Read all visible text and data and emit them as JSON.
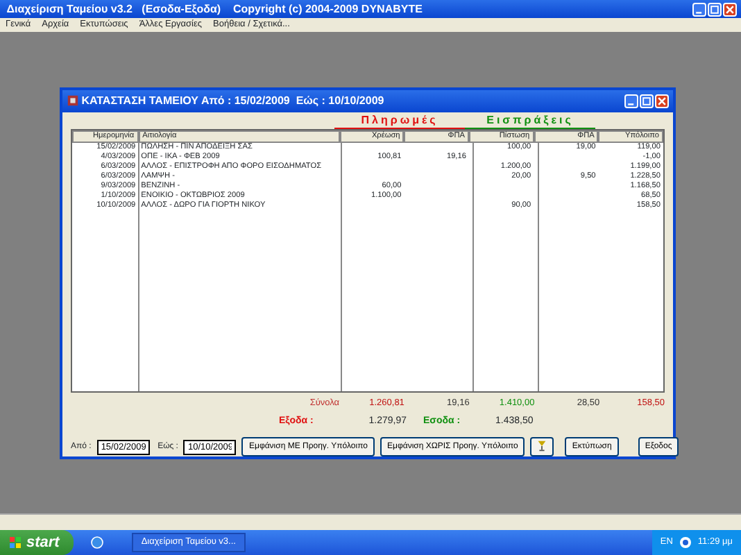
{
  "app": {
    "title": "Διαχείριση Ταμείου v3.2   (Εσοδα-Εξοδα)    Copyright (c) 2004-2009 DYNABYTE"
  },
  "menu": [
    "Γενικά",
    "Αρχεία",
    "Εκτυπώσεις",
    "Άλλες Εργασίες",
    "Βοήθεια / Σχετικά..."
  ],
  "report_window": {
    "title": "ΚΑΤΑΣΤΑΣΗ ΤΑΜΕΙΟΥ Από : 15/02/2009  Εώς : 10/10/2009",
    "groups": [
      {
        "label": "Πληρωμές",
        "color": "#e01010"
      },
      {
        "label": "Εισπράξεις",
        "color": "#109010"
      }
    ],
    "columns": [
      "Ημερομηνία",
      "Αιτιολογία",
      "Χρέωση",
      "ΦΠΑ",
      "Πίστωση",
      "ΦΠΑ",
      "Υπόλοιπο"
    ],
    "rows": [
      [
        "15/02/2009",
        "ΠΩΛΗΣΗ - ΠΙΝ ΑΠΟΔΕΙΞΗ ΣΑΣ",
        "",
        "",
        "100,00",
        "19,00",
        "119,00"
      ],
      [
        "4/03/2009",
        "ΟΠΕ - ΙΚΑ - ΦΕΒ 2009",
        "100,81",
        "19,16",
        "",
        "",
        "-1,00"
      ],
      [
        "6/03/2009",
        "ΑΛΛΟΣ - ΕΠΙΣΤΡΟΦΗ ΑΠΟ ΦΟΡΟ ΕΙΣΟΔΗΜΑΤΟΣ",
        "",
        "",
        "1.200,00",
        "",
        "1.199,00"
      ],
      [
        "6/03/2009",
        "ΛΑΜΨΗ -",
        "",
        "",
        "20,00",
        "9,50",
        "1.228,50"
      ],
      [
        "9/03/2009",
        "ΒΕΝΖΙΝΗ -",
        "60,00",
        "",
        "",
        "",
        "1.168,50"
      ],
      [
        "1/10/2009",
        "ΕΝΟΙΚΙΟ - ΟΚΤΩΒΡΙΟΣ 2009",
        "1.100,00",
        "",
        "",
        "",
        "68,50"
      ],
      [
        "10/10/2009",
        "ΑΛΛΟΣ - ΔΩΡΟ ΓΙΑ ΓΙΟΡΤΗ ΝΙΚΟΥ",
        "",
        "",
        "90,00",
        "",
        "158,50"
      ]
    ],
    "totals": {
      "label": "Σύνολα",
      "values": [
        "1.260,81",
        "19,16",
        "1.410,00",
        "28,50",
        "158,50"
      ]
    },
    "expenses": {
      "label": "Εξοδα :",
      "value": "1.279,97"
    },
    "income": {
      "label": "Εσοδα :",
      "value": "1.438,50"
    },
    "from": {
      "label": "Από :",
      "value": "15/02/2009"
    },
    "to": {
      "label": "Εώς :",
      "value": "10/10/2009"
    },
    "buttons": [
      "Εμφάνιση ΜΕ Προηγ. Υπόλοιπο",
      "Εμφάνιση ΧΩΡΙΣ Προηγ. Υπόλοιπο"
    ],
    "buttons_right": [
      "Εκτύπωση",
      "Εξοδος"
    ]
  },
  "taskbar": {
    "start": "start",
    "task": "Διαχείριση Ταμείου v3...",
    "language": "EN",
    "clock": "11:29 μμ"
  }
}
